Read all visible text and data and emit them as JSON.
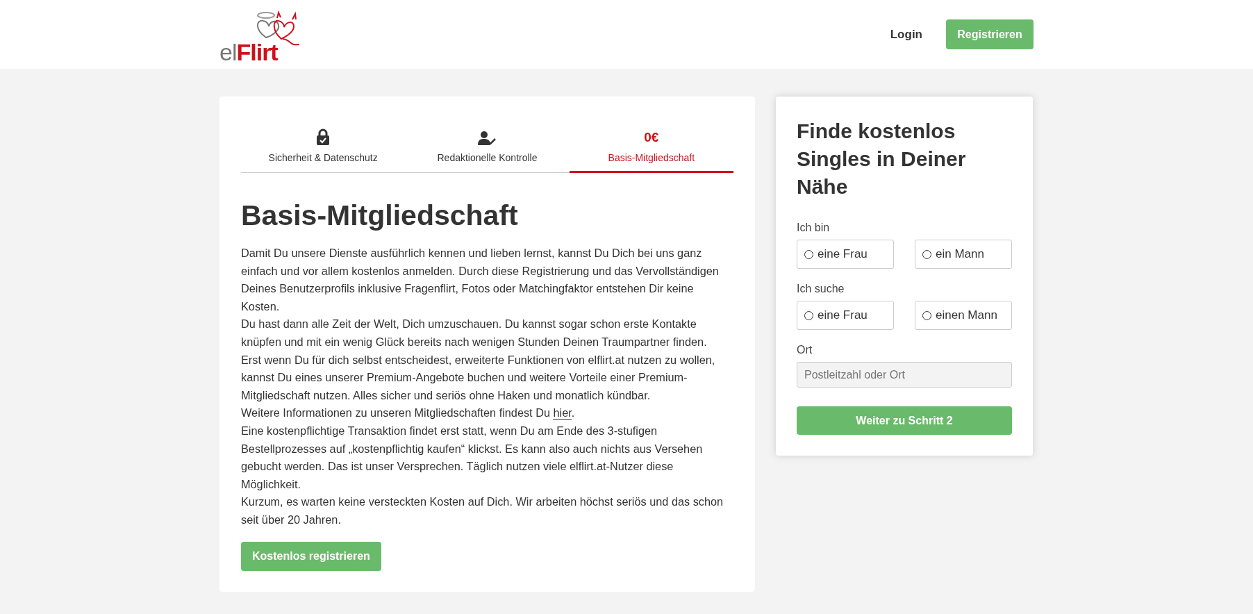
{
  "header": {
    "logo": {
      "light": "el",
      "bold": "Flirt"
    },
    "login": "Login",
    "register": "Registrieren"
  },
  "tabs": [
    {
      "kind": "lock",
      "label": "Sicherheit & Datenschutz",
      "selected": false
    },
    {
      "kind": "user-check",
      "label": "Redaktionelle Kontrolle",
      "selected": false
    },
    {
      "kind": "price",
      "price": "0€",
      "label": "Basis-Mitgliedschaft",
      "selected": true
    }
  ],
  "article": {
    "title": "Basis-Mitgliedschaft",
    "paragraphs": [
      {
        "text": "Damit Du unsere Dienste ausführlich kennen und lieben lernst, kannst Du Dich bei uns ganz einfach und vor allem kostenlos anmelden. Durch diese Registrierung und das Vervollständigen Deines Benutzerprofils inklusive Fragenflirt, Fotos oder Matchingfaktor entstehen Dir keine Kosten."
      },
      {
        "text": "Du hast dann alle Zeit der Welt, Dich umzuschauen. Du kannst sogar schon erste Kontakte knüpfen und mit ein wenig Glück bereits nach wenigen Stunden Deinen Traumpartner finden."
      },
      {
        "text": "Erst wenn Du für dich selbst entscheidest, erweiterte Funktionen von elflirt.at nutzen zu wollen, kannst Du eines unserer Premium-Angebote buchen und weitere Vorteile einer Premium-Mitgliedschaft nutzen. Alles sicher und seriös ohne Haken und monatlich kündbar."
      },
      {
        "text": "Weitere Informationen zu unseren Mitgliedschaften findest Du ",
        "link": "hier",
        "after": "."
      },
      {
        "text": "Eine kostenpflichtige Transaktion findet erst statt, wenn Du am Ende des 3-stufigen Bestellprozesses auf „kostenpflichtig kaufen“ klickst. Es kann also auch nichts aus Versehen gebucht werden. Das ist unser Versprechen. Täglich nutzen viele elflirt.at-Nutzer diese Möglichkeit."
      },
      {
        "text": "Kurzum, es warten keine versteckten Kosten auf Dich. Wir arbeiten höchst seriös und das schon seit über 20 Jahren."
      }
    ],
    "button": "Kostenlos registrieren"
  },
  "signup": {
    "title": "Finde kostenlos Singles in Deiner Nähe",
    "groups": [
      {
        "label": "Ich bin",
        "options": [
          {
            "label": "eine Frau",
            "selected": false
          },
          {
            "label": "ein Mann",
            "selected": false
          }
        ]
      },
      {
        "label": "Ich suche",
        "options": [
          {
            "label": "eine Frau",
            "selected": false
          },
          {
            "label": "einen Mann",
            "selected": false
          }
        ]
      }
    ],
    "location": {
      "label": "Ort",
      "placeholder": "Postleitzahl oder Ort"
    },
    "button": "Weiter zu Schritt 2"
  }
}
